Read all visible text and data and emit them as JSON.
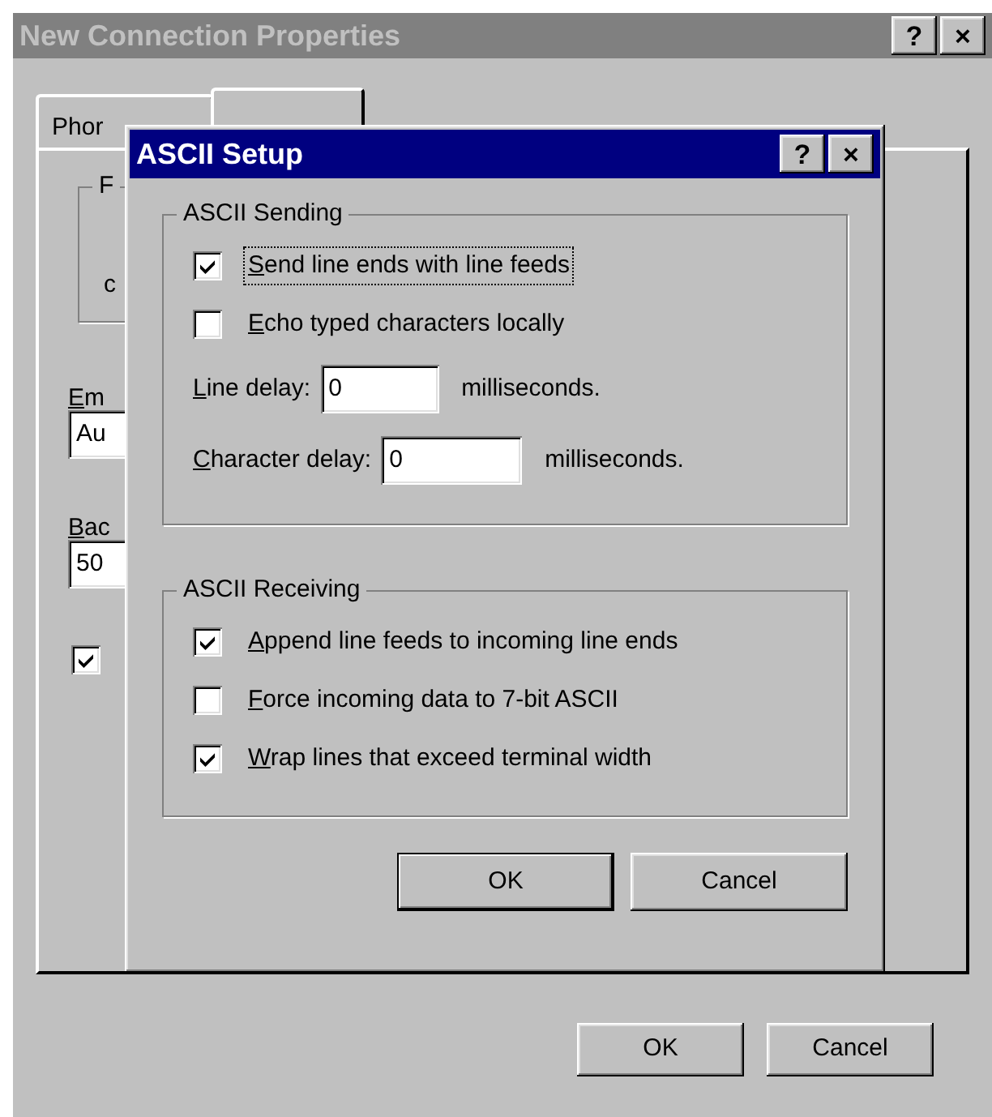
{
  "background_window": {
    "title": "New Connection Properties",
    "active": false,
    "title_buttons": [
      "?",
      "×"
    ],
    "tabs": [
      {
        "label": "Phor",
        "selected": false
      },
      {
        "selected": true
      }
    ],
    "fragments": [
      {
        "kind": "group",
        "text": "F"
      },
      {
        "kind": "label",
        "text": "c"
      },
      {
        "kind": "label",
        "text": "Em",
        "mnemonic": true
      },
      {
        "kind": "field",
        "text": "Au"
      },
      {
        "kind": "label",
        "text": "Bac",
        "mnemonic": true
      },
      {
        "kind": "field",
        "text": "50"
      },
      {
        "kind": "checkbox",
        "checked": true
      }
    ],
    "buttons": [
      {
        "label": "OK",
        "default": false
      },
      {
        "label": "Cancel",
        "default": false
      }
    ]
  },
  "dialog": {
    "title": "ASCII Setup",
    "active": true,
    "title_buttons": [
      "?",
      "×"
    ],
    "groups": [
      {
        "title": "ASCII Sending",
        "items": [
          {
            "kind": "checkbox",
            "label": "Send line ends with line feeds",
            "checked": true,
            "focused": true,
            "mnemonic": true
          },
          {
            "kind": "checkbox",
            "label": "Echo typed characters locally",
            "checked": false,
            "focused": false,
            "mnemonic": true
          },
          {
            "kind": "number",
            "label": "Line delay:",
            "value": "0",
            "unit": "milliseconds.",
            "mnemonic": true
          },
          {
            "kind": "number",
            "label": "Character delay:",
            "value": "0",
            "unit": "milliseconds.",
            "mnemonic": true
          }
        ]
      },
      {
        "title": "ASCII Receiving",
        "items": [
          {
            "kind": "checkbox",
            "label": "Append line feeds to incoming line ends",
            "checked": true,
            "focused": false,
            "mnemonic": true
          },
          {
            "kind": "checkbox",
            "label": "Force incoming data to 7-bit ASCII",
            "checked": false,
            "focused": false,
            "mnemonic": true
          },
          {
            "kind": "checkbox",
            "label": "Wrap lines that exceed terminal width",
            "checked": true,
            "focused": false,
            "mnemonic": true
          }
        ]
      }
    ],
    "buttons": [
      {
        "label": "OK",
        "default": true
      },
      {
        "label": "Cancel",
        "default": false
      }
    ]
  }
}
